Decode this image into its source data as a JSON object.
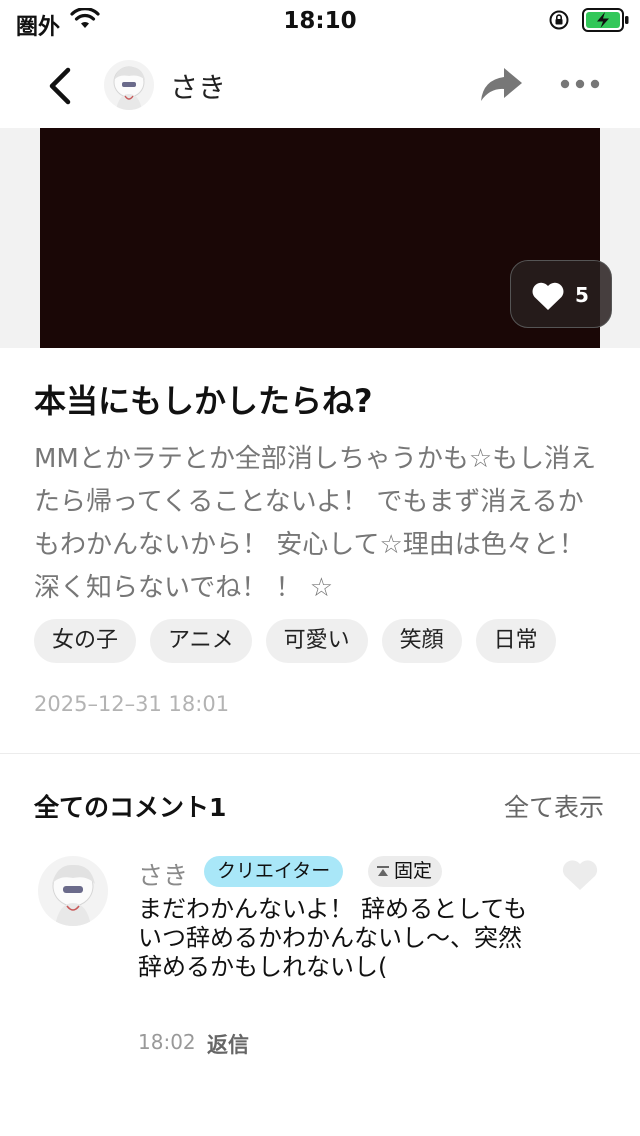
{
  "status_bar": {
    "carrier": "圏外",
    "time": "18:10"
  },
  "nav": {
    "username": "さき",
    "icons": [
      "back-icon",
      "share-icon",
      "more-icon"
    ]
  },
  "media": {
    "like_count": "5"
  },
  "post": {
    "title": "本当にもしかしたらね?",
    "body": "MMとかラテとか全部消しちゃうかも☆もし消えたら帰ってくることないよ！ でもまず消えるかもわかんないから！ 安心して☆理由は色々と！ 深く知らないでね！ ！ ☆",
    "tags": [
      "女の子",
      "アニメ",
      "可愛い",
      "笑顔",
      "日常"
    ],
    "date": "2025–12–31 18:01"
  },
  "comments": {
    "title": "全てのコメント1",
    "show_all": "全て表示",
    "items": [
      {
        "name": "さき",
        "badge_creator": "クリエイター",
        "badge_pinned": "固定",
        "text": "まだわかんないよ！ 辞めるとしてもいつ辞めるかわかんないし～、突然辞めるかもしれないし(",
        "time": "18:02",
        "reply": "返信"
      }
    ]
  },
  "colors": {
    "media_bg": "#1a0706",
    "creator_badge": "#a9e7f8",
    "tag_bg": "#efefef",
    "battery_green": "#33c759"
  }
}
